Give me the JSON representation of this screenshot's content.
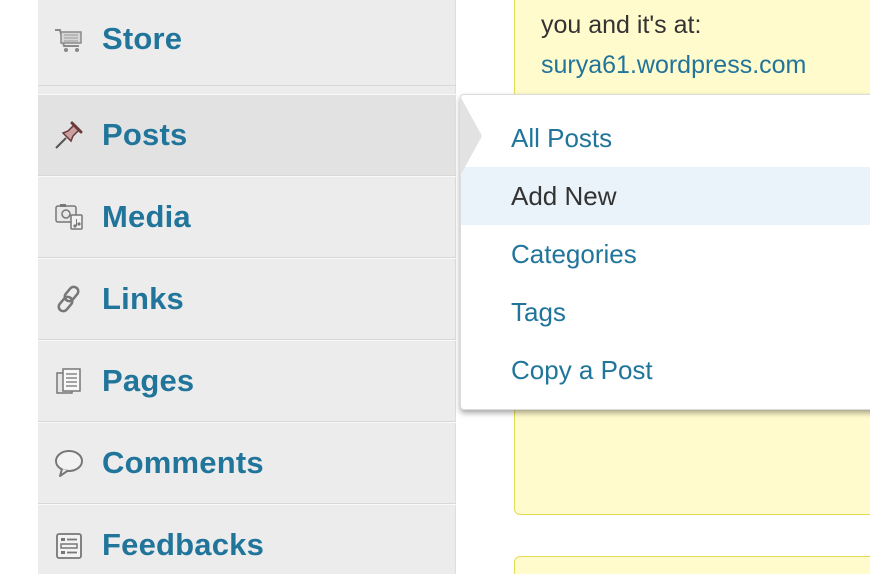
{
  "sidebar": {
    "items": [
      {
        "label": "Store",
        "icon": "cart-icon"
      },
      {
        "label": "Posts",
        "icon": "pushpin-icon"
      },
      {
        "label": "Media",
        "icon": "media-icon"
      },
      {
        "label": "Links",
        "icon": "chain-link-icon"
      },
      {
        "label": "Pages",
        "icon": "pages-icon"
      },
      {
        "label": "Comments",
        "icon": "speech-bubble-icon"
      },
      {
        "label": "Feedbacks",
        "icon": "feedback-icon"
      }
    ]
  },
  "submenu": {
    "items": [
      {
        "label": "All Posts"
      },
      {
        "label": "Add New"
      },
      {
        "label": "Categories"
      },
      {
        "label": "Tags"
      },
      {
        "label": "Copy a Post"
      }
    ]
  },
  "notice": {
    "text": "you and it's at:",
    "link": "surya61.wordpress.com"
  },
  "colors": {
    "link": "#21759b",
    "sidebar_bg": "#ececec",
    "notice_bg": "#fffbcc",
    "notice_border": "#e6db55",
    "submenu_hover": "#eaf2fa"
  }
}
